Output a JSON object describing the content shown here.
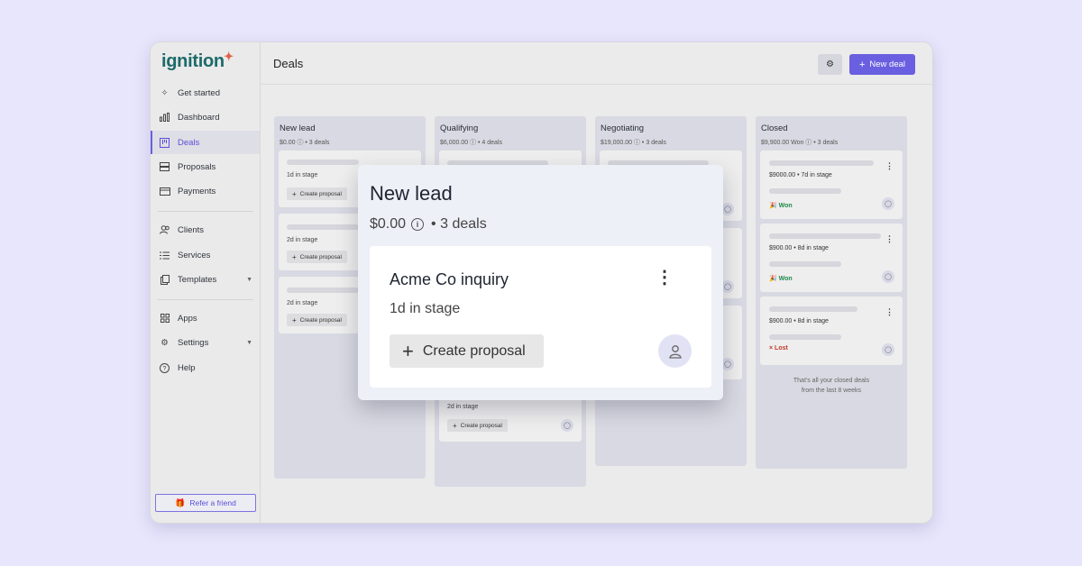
{
  "app": {
    "logo": "ignition",
    "page_title": "Deals"
  },
  "sidebar": {
    "items": [
      {
        "label": "Get started",
        "icon": "sparkle-icon"
      },
      {
        "label": "Dashboard",
        "icon": "bar-chart-icon"
      },
      {
        "label": "Deals",
        "icon": "kanban-icon",
        "active": true
      },
      {
        "label": "Proposals",
        "icon": "proposal-icon"
      },
      {
        "label": "Payments",
        "icon": "card-icon"
      },
      {
        "label": "Clients",
        "icon": "users-icon"
      },
      {
        "label": "Services",
        "icon": "list-icon"
      },
      {
        "label": "Templates",
        "icon": "copy-icon",
        "has_caret": true
      },
      {
        "label": "Apps",
        "icon": "grid-icon"
      },
      {
        "label": "Settings",
        "icon": "gear-icon",
        "has_caret": true
      },
      {
        "label": "Help",
        "icon": "help-icon"
      }
    ],
    "refer_label": "Refer a friend"
  },
  "header": {
    "new_deal_label": "New deal"
  },
  "columns": [
    {
      "title": "New lead",
      "meta": "$0.00 ⓘ • 3 deals",
      "cards": [
        {
          "stage": "1d in stage",
          "button": "Create proposal"
        },
        {
          "stage": "2d in stage",
          "button": "Create proposal"
        },
        {
          "stage": "2d in stage",
          "button": "Create proposal"
        }
      ]
    },
    {
      "title": "Qualifying",
      "meta": "$6,000.00 ⓘ • 4 deals",
      "cards": [
        {
          "stage": "2d in stage",
          "button": "Create proposal"
        }
      ]
    },
    {
      "title": "Negotiating",
      "meta": "$19,000.00 ⓘ • 3 deals"
    },
    {
      "title": "Closed",
      "meta": "$9,900.00 Won ⓘ • 3 deals",
      "cards": [
        {
          "amount": "$9000.00 • 7d in stage",
          "status": "Won"
        },
        {
          "amount": "$900.00 • 8d in stage",
          "status": "Won"
        },
        {
          "amount": "$900.00 • 8d in stage",
          "status": "Lost"
        }
      ],
      "footer_line1": "That's all your closed deals",
      "footer_line2": "from the last 8 weeks"
    }
  ],
  "popup": {
    "title": "New lead",
    "amount": "$0.00",
    "deals": "• 3 deals",
    "card": {
      "title": "Acme Co inquiry",
      "stage": "1d in stage",
      "button": "Create proposal"
    }
  },
  "colors": {
    "accent": "#6a5fe0",
    "won": "#1d8a4c",
    "lost": "#c0392b",
    "logo": "#1d6a6a"
  }
}
